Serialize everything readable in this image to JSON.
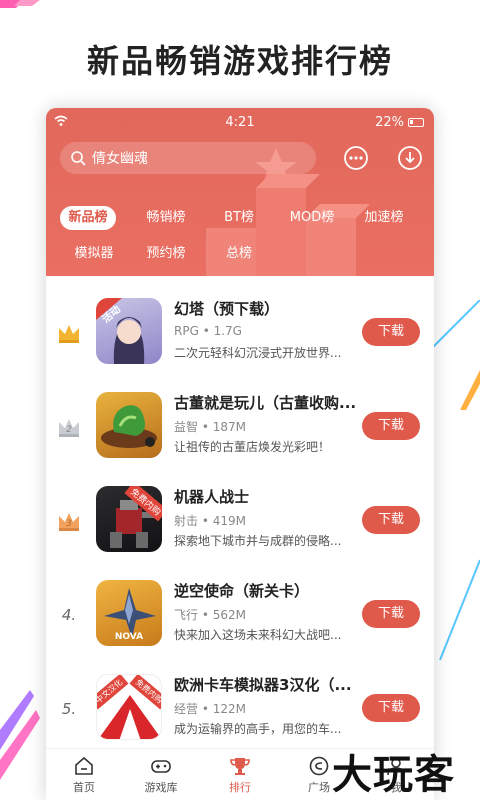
{
  "headline": "新品畅销游戏排行榜",
  "status": {
    "time": "4:21",
    "battery": "22%"
  },
  "search": {
    "placeholder": "倩女幽魂"
  },
  "tabs": [
    "新品榜",
    "畅销榜",
    "BT榜",
    "MOD榜",
    "加速榜",
    "模拟器",
    "预约榜",
    "总榜"
  ],
  "active_tab": "新品榜",
  "games": [
    {
      "rank": "1",
      "title": "幻塔（预下载）",
      "meta": "RPG • 1.7G",
      "desc": "二次元轻科幻沉浸式开放世界...",
      "button": "下载",
      "badge": "活动"
    },
    {
      "rank": "2",
      "title": "古董就是玩儿（古董收购...",
      "meta": "益智 • 187M",
      "desc": "让祖传的古董店焕发光彩吧！",
      "button": "下载"
    },
    {
      "rank": "3",
      "title": "机器人战士",
      "meta": "射击 • 419M",
      "desc": "探索地下城市并与成群的侵略...",
      "button": "下载",
      "badge": "免费内购"
    },
    {
      "rank": "4.",
      "title": "逆空使命（新关卡）",
      "meta": "飞行 • 562M",
      "desc": "快来加入这场未来科幻大战吧...",
      "button": "下载",
      "thumb_text": "NOVA"
    },
    {
      "rank": "5.",
      "title": "欧洲卡车模拟器3汉化（...",
      "meta": "经营 • 122M",
      "desc": "成为运输界的高手，用您的车...",
      "button": "下载",
      "badge": "免费内购",
      "badge2": "中文汉化"
    }
  ],
  "tabbar": [
    {
      "label": "首页",
      "icon": "home-icon"
    },
    {
      "label": "游戏库",
      "icon": "gamepad-icon"
    },
    {
      "label": "排行",
      "icon": "trophy-icon",
      "active": true
    },
    {
      "label": "广场",
      "icon": "compass-icon"
    },
    {
      "label": "我",
      "icon": "user-icon"
    }
  ],
  "watermark": "大玩客",
  "colors": {
    "accent": "#e05a4c",
    "hero": "#e8695c"
  }
}
